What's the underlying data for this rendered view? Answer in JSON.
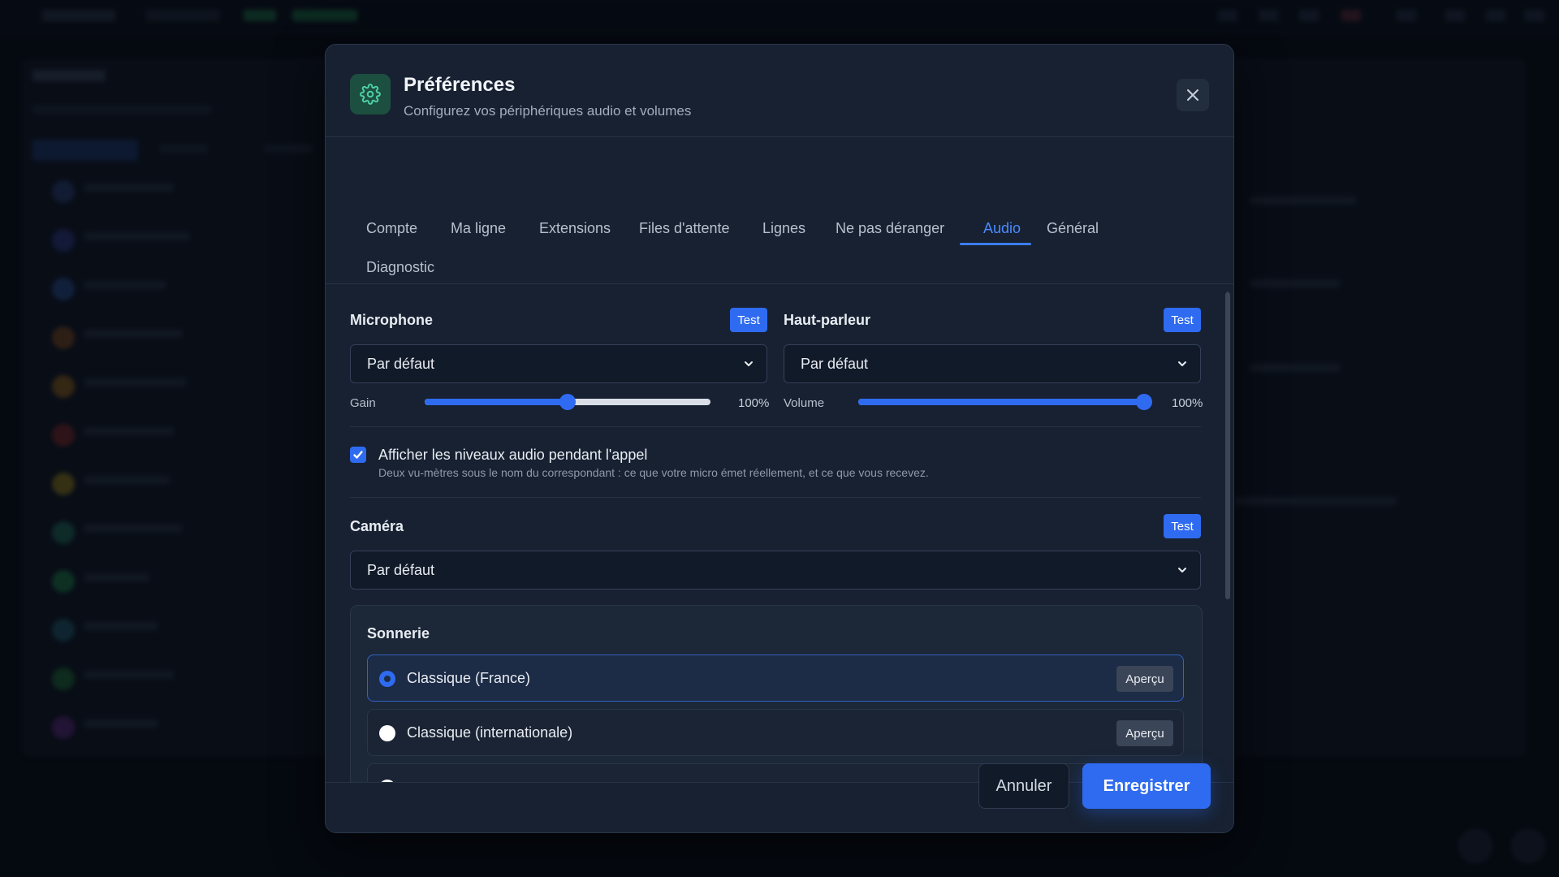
{
  "modal": {
    "title": "Préférences",
    "subtitle": "Configurez vos périphériques audio et volumes",
    "icon": "gear-icon",
    "close_icon": "close-icon"
  },
  "tabs": [
    {
      "label": "Compte",
      "active": false
    },
    {
      "label": "Ma ligne",
      "active": false
    },
    {
      "label": "Extensions",
      "active": false
    },
    {
      "label": "Files d'attente",
      "active": false
    },
    {
      "label": "Lignes",
      "active": false
    },
    {
      "label": "Ne pas déranger",
      "active": false
    },
    {
      "label": "Audio",
      "active": true
    },
    {
      "label": "Général",
      "active": false
    },
    {
      "label": "Diagnostic",
      "active": false
    }
  ],
  "microphone": {
    "label": "Microphone",
    "test_label": "Test",
    "device": "Par défaut",
    "gain_label": "Gain",
    "gain_value": "100%",
    "gain_position": 0.5
  },
  "speaker": {
    "label": "Haut-parleur",
    "test_label": "Test",
    "device": "Par défaut",
    "volume_label": "Volume",
    "volume_value": "100%",
    "volume_position": 1.0
  },
  "audio_levels": {
    "checked": true,
    "label": "Afficher les niveaux audio pendant l'appel",
    "description": "Deux vu-mètres sous le nom du correspondant : ce que votre micro émet réellement, et ce que vous recevez."
  },
  "camera": {
    "label": "Caméra",
    "test_label": "Test",
    "device": "Par défaut"
  },
  "ringtone": {
    "title": "Sonnerie",
    "preview_label": "Aperçu",
    "options": [
      {
        "label": "Classique (France)",
        "selected": true
      },
      {
        "label": "Classique (internationale)",
        "selected": false
      }
    ]
  },
  "footer": {
    "cancel_label": "Annuler",
    "save_label": "Enregistrer"
  },
  "colors": {
    "accent": "#2f6bf0",
    "tab_active": "#4b8bff",
    "header_icon_bg": "#1d4f40",
    "header_icon_fg": "#4fd1a5"
  }
}
